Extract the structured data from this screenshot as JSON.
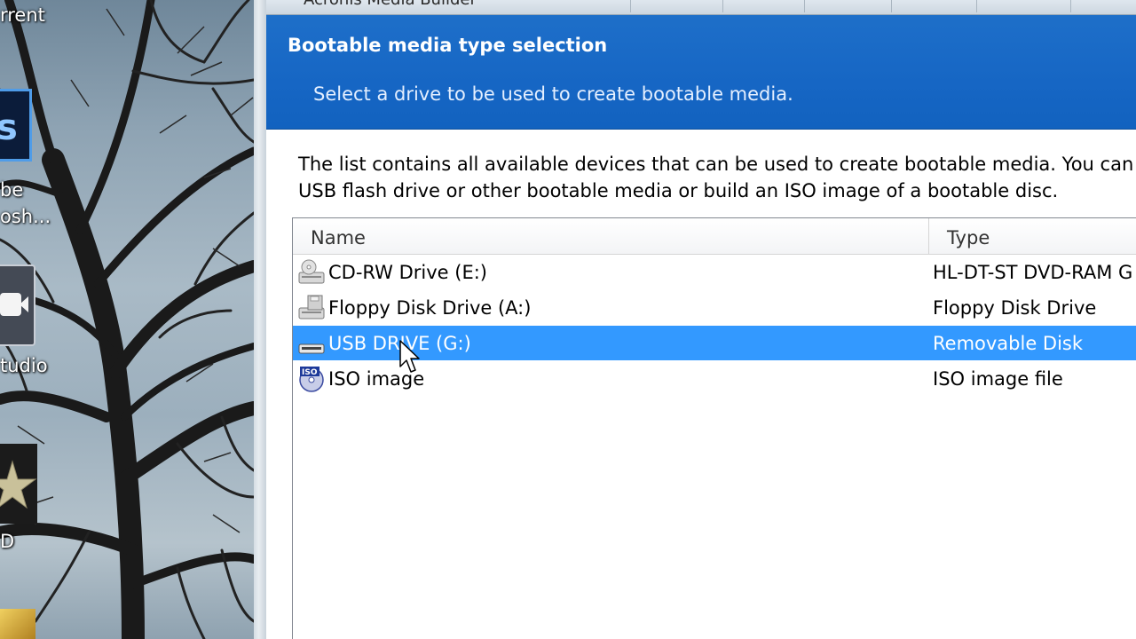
{
  "desktop": {
    "labels": {
      "top": "rrent",
      "photoshop_line1": "be",
      "photoshop_line2": "osh...",
      "studio": "tudio",
      "d": "D"
    },
    "icons": {
      "photoshop": "photoshop-icon",
      "video": "video-camera-icon",
      "star": "star-icon"
    }
  },
  "window": {
    "title_partial": "Acronis Media Builder",
    "header": {
      "title": "Bootable media type selection",
      "subtitle": "Select a drive to be used to create bootable media."
    },
    "description": {
      "line1": "The list contains all available devices that can be used to create bootable media. You can c",
      "line2": "USB flash drive or other bootable media or build an ISO image of a bootable disc."
    },
    "list": {
      "columns": [
        "Name",
        "Type"
      ],
      "rows": [
        {
          "name": "CD-RW Drive (E:)",
          "type": "HL-DT-ST DVD-RAM G",
          "icon": "cd-drive-icon",
          "selected": false
        },
        {
          "name": "Floppy Disk Drive (A:)",
          "type": "Floppy Disk Drive",
          "icon": "floppy-drive-icon",
          "selected": false
        },
        {
          "name": "USB DRIVE (G:)",
          "type": "Removable Disk",
          "icon": "usb-drive-icon",
          "selected": true
        },
        {
          "name": "ISO image",
          "type": "ISO image file",
          "icon": "iso-image-icon",
          "selected": false
        }
      ]
    }
  },
  "colors": {
    "header_blue": "#1666c4",
    "selection_blue": "#3399ff"
  }
}
